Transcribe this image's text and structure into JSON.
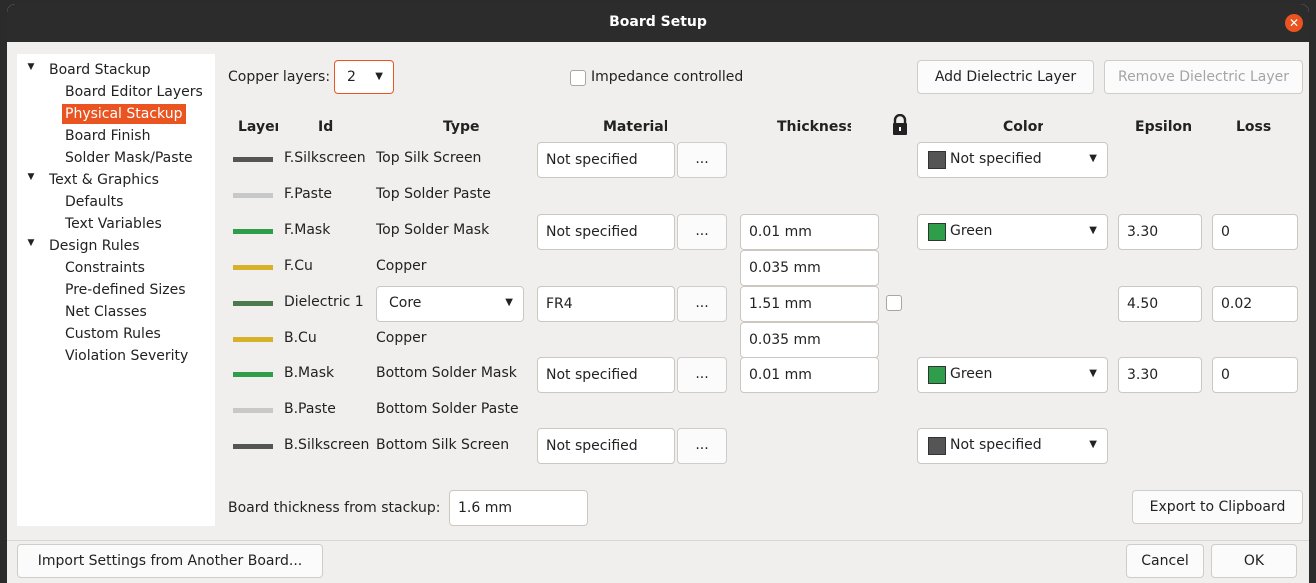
{
  "window": {
    "title": "Board Setup"
  },
  "tree": {
    "items": [
      {
        "label": "Board Stackup",
        "arrow": "▼"
      },
      {
        "label": "Board Editor Layers"
      },
      {
        "label": "Physical Stackup"
      },
      {
        "label": "Board Finish"
      },
      {
        "label": "Solder Mask/Paste"
      },
      {
        "label": "Text & Graphics",
        "arrow": "▼"
      },
      {
        "label": "Defaults"
      },
      {
        "label": "Text Variables"
      },
      {
        "label": "Design Rules",
        "arrow": "▼"
      },
      {
        "label": "Constraints"
      },
      {
        "label": "Pre-defined Sizes"
      },
      {
        "label": "Net Classes"
      },
      {
        "label": "Custom Rules"
      },
      {
        "label": "Violation Severity"
      }
    ]
  },
  "top": {
    "copper_layers_label": "Copper layers:",
    "copper_layers_value": "2",
    "impedance_label": "Impedance controlled",
    "add_dielectric": "Add Dielectric Layer",
    "remove_dielectric": "Remove Dielectric Layer"
  },
  "headers": {
    "layer": "Layer",
    "id": "Id",
    "type": "Type",
    "material": "Material",
    "thickness": "Thickness",
    "color": "Color",
    "epsilon": "Epsilon",
    "loss": "Loss"
  },
  "rows": [
    {
      "id": "F.Silkscreen",
      "type": "Top Silk Screen",
      "material": "Not specified",
      "ellipsis": "...",
      "color": "Not specified",
      "swatch": "#555555",
      "colorbox": "#555555"
    },
    {
      "id": "F.Paste",
      "type": "Top Solder Paste",
      "swatch": "#c8c8c8"
    },
    {
      "id": "F.Mask",
      "type": "Top Solder Mask",
      "material": "Not specified",
      "ellipsis": "...",
      "thickness": "0.01 mm",
      "color": "Green",
      "swatch": "#2e9e4b",
      "colorbox": "#2e9e4b",
      "epsilon": "3.30",
      "loss": "0"
    },
    {
      "id": "F.Cu",
      "type": "Copper",
      "thickness": "0.035 mm",
      "swatch": "#d8b12a"
    },
    {
      "id": "Dielectric 1",
      "type": "Core",
      "material": "FR4",
      "ellipsis": "...",
      "thickness": "1.51 mm",
      "epsilon": "4.50",
      "loss": "0.02",
      "swatch": "#4c7a4c"
    },
    {
      "id": "B.Cu",
      "type": "Copper",
      "thickness": "0.035 mm",
      "swatch": "#d8b12a"
    },
    {
      "id": "B.Mask",
      "type": "Bottom Solder Mask",
      "material": "Not specified",
      "ellipsis": "...",
      "thickness": "0.01 mm",
      "color": "Green",
      "swatch": "#2e9e4b",
      "colorbox": "#2e9e4b",
      "epsilon": "3.30",
      "loss": "0"
    },
    {
      "id": "B.Paste",
      "type": "Bottom Solder Paste",
      "swatch": "#c8c8c8"
    },
    {
      "id": "B.Silkscreen",
      "type": "Bottom Silk Screen",
      "material": "Not specified",
      "ellipsis": "...",
      "color": "Not specified",
      "swatch": "#555555",
      "colorbox": "#555555"
    }
  ],
  "bottom": {
    "board_thickness_label": "Board thickness from stackup:",
    "board_thickness_value": "1.6 mm",
    "export_button": "Export to Clipboard"
  },
  "footer": {
    "import_button": "Import Settings from Another Board...",
    "cancel_button": "Cancel",
    "ok_button": "OK"
  }
}
